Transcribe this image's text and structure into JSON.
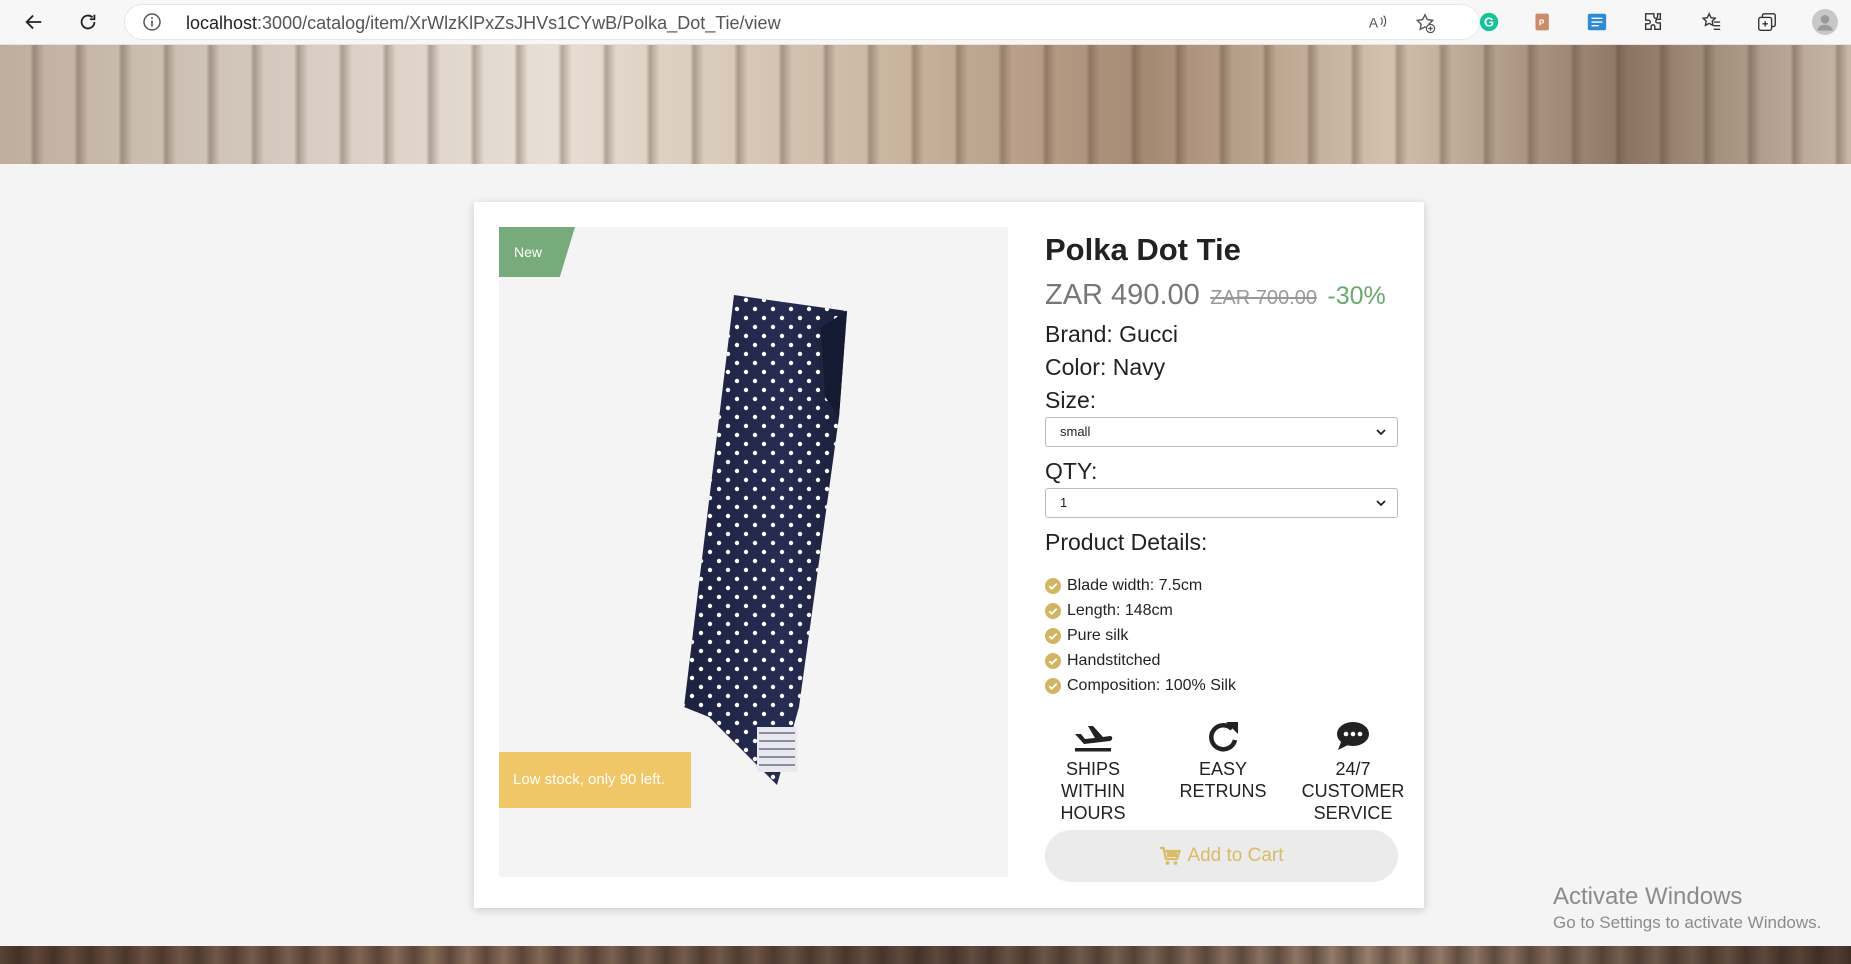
{
  "browser": {
    "url_host": "localhost",
    "url_path": ":3000/catalog/item/XrWlzKlPxZsJHVs1CYwB/Polka_Dot_Tie/view"
  },
  "product": {
    "badge": "New",
    "stock_note": "Low stock, only 90 left.",
    "title": "Polka Dot Tie",
    "price": "ZAR 490.00",
    "old_price": "ZAR 700.00",
    "discount": "-30%",
    "brand": "Brand: Gucci",
    "color": "Color: Navy",
    "size_label": "Size:",
    "size_value": "small",
    "qty_label": "QTY:",
    "qty_value": "1",
    "details_label": "Product Details:",
    "features": [
      "Blade width: 7.5cm",
      "Length: 148cm",
      "Pure silk",
      "Handstitched",
      "Composition: 100% Silk"
    ],
    "services": [
      {
        "line1": "SHIPS",
        "line2": "WITHIN",
        "line3": "HOURS",
        "icon": "plane-icon"
      },
      {
        "line1": "EASY",
        "line2": "RETRUNS",
        "icon": "redo-icon"
      },
      {
        "line1": "24/7",
        "line2": "CUSTOMER",
        "line3": "SERVICE",
        "icon": "chat-icon"
      }
    ],
    "add_to_cart": "Add to Cart"
  },
  "watermark": {
    "line1": "Activate Windows",
    "line2": "Go to Settings to activate Windows."
  },
  "colors": {
    "accent_green": "#77ab7b",
    "discount_green": "#6aa96f",
    "stock_yellow": "#efc766",
    "check_gold": "#d2b560"
  }
}
